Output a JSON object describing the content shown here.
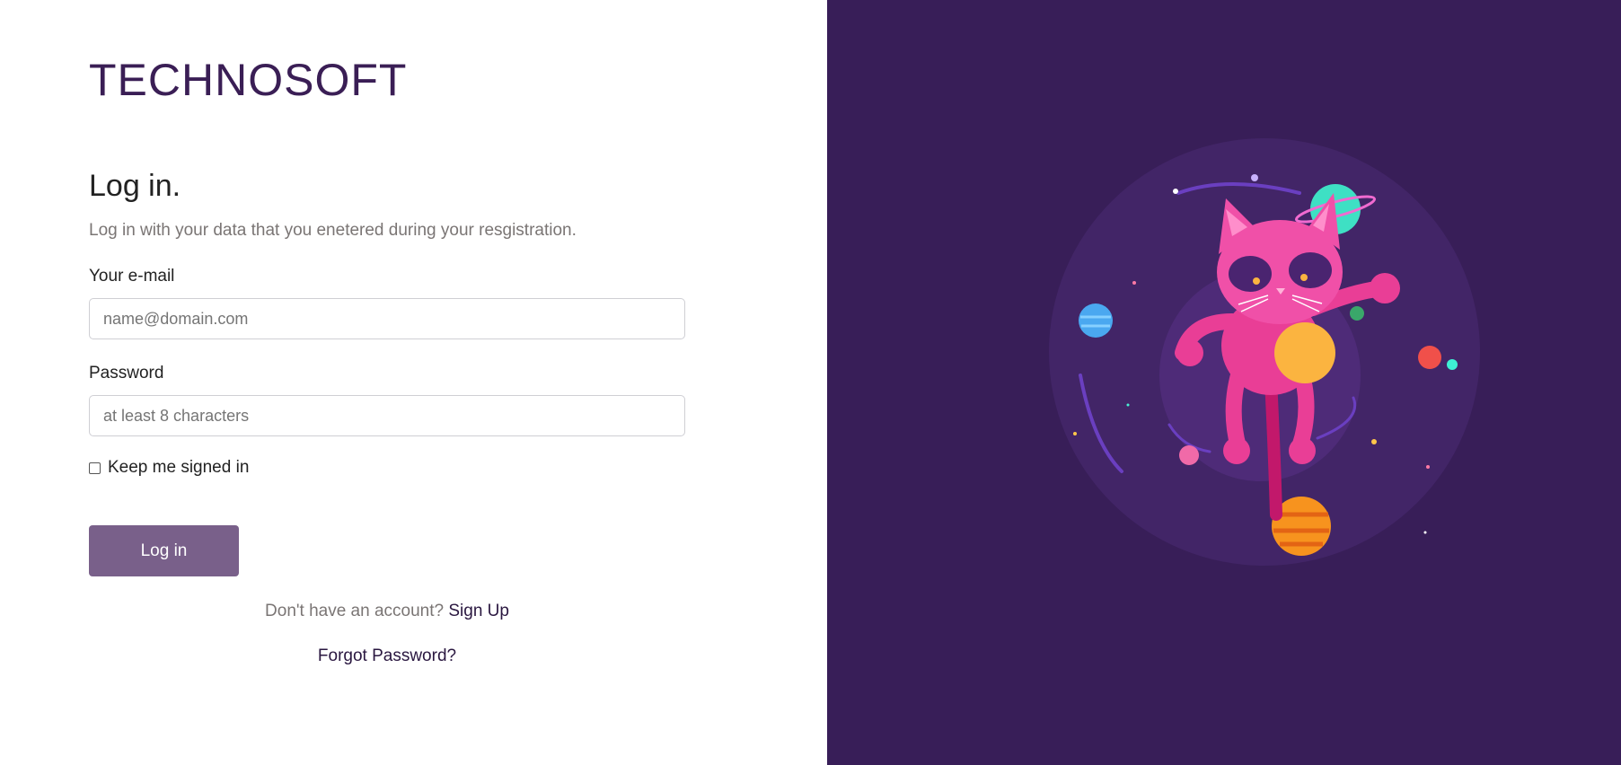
{
  "brand": {
    "name": "TECHNOSOFT"
  },
  "login": {
    "title": "Log in.",
    "subtitle": "Log in with your data that you enetered during your resgistration.",
    "email_label": "Your e-mail",
    "email_placeholder": "name@domain.com",
    "password_label": "Password",
    "password_placeholder": "at least 8 characters",
    "keep_signed_in_label": "Keep me signed in",
    "submit_label": "Log in",
    "no_account_text": "Don't have an account?",
    "signup_label": "Sign Up",
    "forgot_label": "Forgot Password?"
  },
  "colors": {
    "brand": "#3a1e55",
    "button": "#79608a",
    "panel": "#381e58"
  },
  "illustration": {
    "subject": "space-cat-icon"
  }
}
